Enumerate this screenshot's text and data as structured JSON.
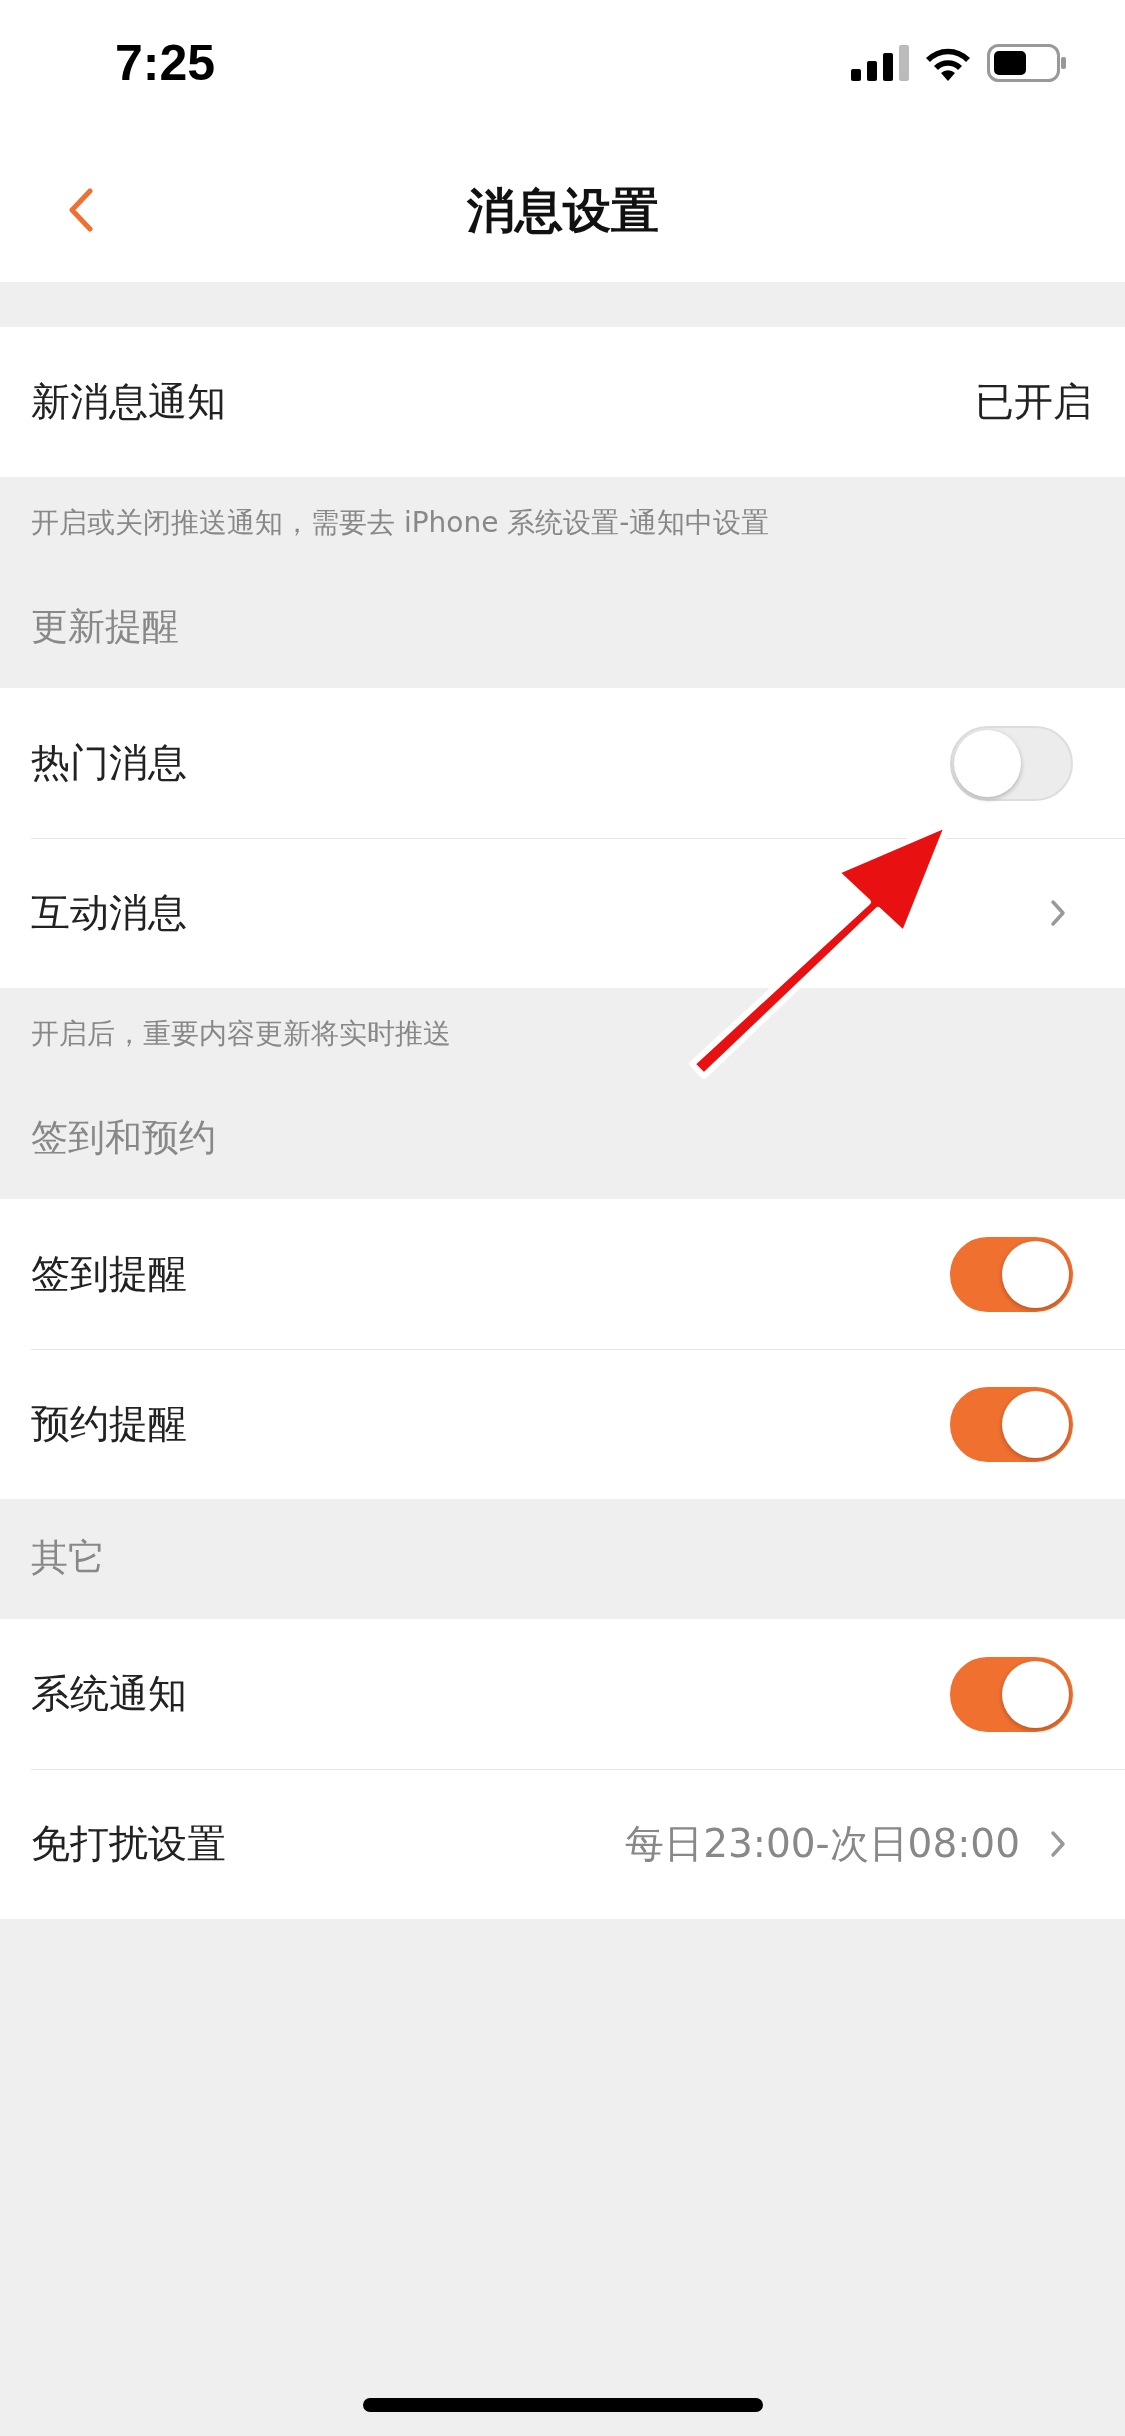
{
  "status_bar": {
    "time": "7:25"
  },
  "nav": {
    "title": "消息设置"
  },
  "sections": [
    {
      "rows": [
        {
          "kind": "value",
          "label": "新消息通知",
          "value": "已开启"
        }
      ],
      "footer": "开启或关闭推送通知，需要去 iPhone 系统设置-通知中设置"
    },
    {
      "header": "更新提醒",
      "rows": [
        {
          "kind": "toggle",
          "label": "热门消息",
          "on": false
        },
        {
          "kind": "link",
          "label": "互动消息"
        }
      ],
      "footer": "开启后，重要内容更新将实时推送"
    },
    {
      "header": "签到和预约",
      "rows": [
        {
          "kind": "toggle",
          "label": "签到提醒",
          "on": true
        },
        {
          "kind": "toggle",
          "label": "预约提醒",
          "on": true
        }
      ]
    },
    {
      "header": "其它",
      "rows": [
        {
          "kind": "toggle",
          "label": "系统通知",
          "on": true
        },
        {
          "kind": "link",
          "label": "免打扰设置",
          "value": "每日23:00-次日08:00"
        }
      ]
    }
  ],
  "annotation": {
    "kind": "arrow"
  }
}
